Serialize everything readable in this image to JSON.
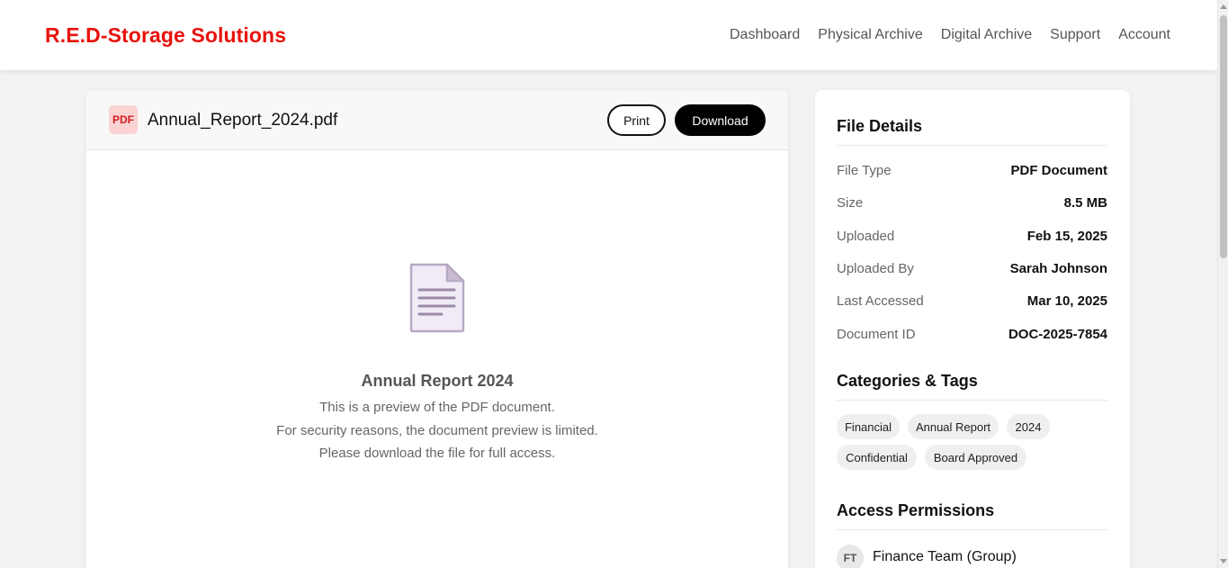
{
  "header": {
    "brand": "R.E.D-Storage Solutions",
    "nav": [
      "Dashboard",
      "Physical Archive",
      "Digital Archive",
      "Support",
      "Account"
    ]
  },
  "viewer": {
    "file_badge": "PDF",
    "file_name": "Annual_Report_2024.pdf",
    "print_label": "Print",
    "download_label": "Download",
    "preview_title": "Annual Report 2024",
    "preview_lines": [
      "This is a preview of the PDF document.",
      "For security reasons, the document preview is limited.",
      "Please download the file for full access."
    ],
    "icon": "document-icon"
  },
  "file_details": {
    "title": "File Details",
    "rows": [
      {
        "label": "File Type",
        "value": "PDF Document"
      },
      {
        "label": "Size",
        "value": "8.5 MB"
      },
      {
        "label": "Uploaded",
        "value": "Feb 15, 2025"
      },
      {
        "label": "Uploaded By",
        "value": "Sarah Johnson"
      },
      {
        "label": "Last Accessed",
        "value": "Mar 10, 2025"
      },
      {
        "label": "Document ID",
        "value": "DOC-2025-7854"
      }
    ]
  },
  "categories": {
    "title": "Categories & Tags",
    "tags": [
      "Financial",
      "Annual Report",
      "2024",
      "Confidential",
      "Board Approved"
    ]
  },
  "permissions": {
    "title": "Access Permissions",
    "items": [
      {
        "initials": "FT",
        "name": "Finance Team (Group)"
      }
    ]
  },
  "colors": {
    "brand": "#e8120c",
    "button_dark": "#000000",
    "pdf_badge_bg": "#fbd3d3",
    "doc_icon_fill": "#f1ebf7",
    "doc_icon_stroke": "#b8a9c4"
  }
}
